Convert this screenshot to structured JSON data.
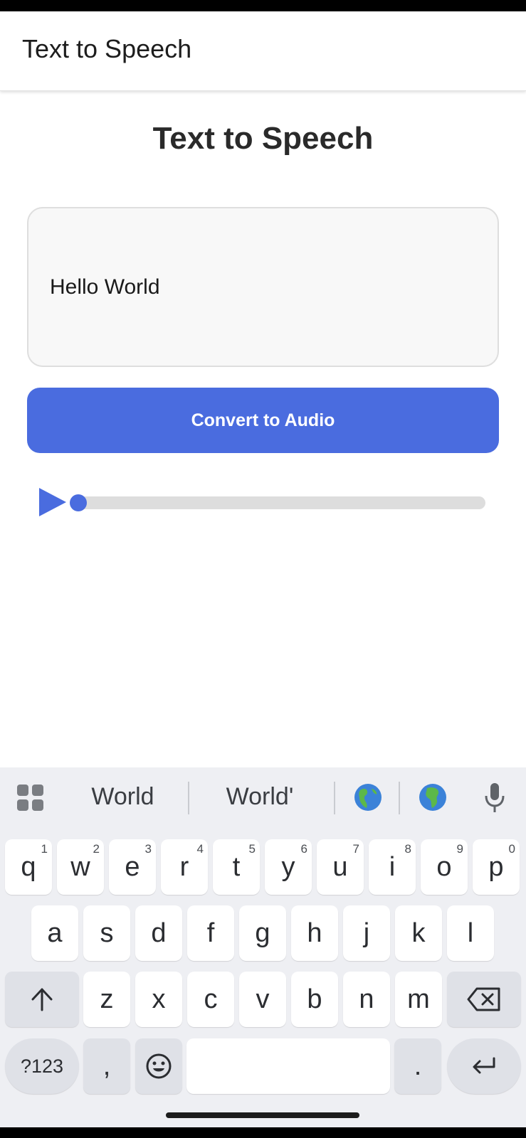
{
  "app_bar": {
    "title": "Text to Speech"
  },
  "main": {
    "heading": "Text to Speech",
    "text_input": {
      "value": "Hello World"
    },
    "convert_button": "Convert to Audio",
    "player": {
      "progress_fraction": 0.0
    }
  },
  "colors": {
    "accent": "#4a6cdf",
    "track": "#dddddd"
  },
  "keyboard": {
    "suggestions": [
      "World",
      "World'"
    ],
    "row1": [
      {
        "label": "q",
        "hint": "1"
      },
      {
        "label": "w",
        "hint": "2"
      },
      {
        "label": "e",
        "hint": "3"
      },
      {
        "label": "r",
        "hint": "4"
      },
      {
        "label": "t",
        "hint": "5"
      },
      {
        "label": "y",
        "hint": "6"
      },
      {
        "label": "u",
        "hint": "7"
      },
      {
        "label": "i",
        "hint": "8"
      },
      {
        "label": "o",
        "hint": "9"
      },
      {
        "label": "p",
        "hint": "0"
      }
    ],
    "row2": [
      "a",
      "s",
      "d",
      "f",
      "g",
      "h",
      "j",
      "k",
      "l"
    ],
    "row3": [
      "z",
      "x",
      "c",
      "v",
      "b",
      "n",
      "m"
    ],
    "symbols_key": "?123",
    "comma_key": ",",
    "period_key": ".",
    "icons": {
      "apps": "apps-grid-icon",
      "globe_americas": "globe-americas-icon",
      "globe_africa": "globe-africa-icon",
      "mic": "microphone-icon",
      "shift": "shift-arrow-icon",
      "backspace": "backspace-icon",
      "emoji": "emoji-icon",
      "enter": "enter-icon"
    }
  }
}
